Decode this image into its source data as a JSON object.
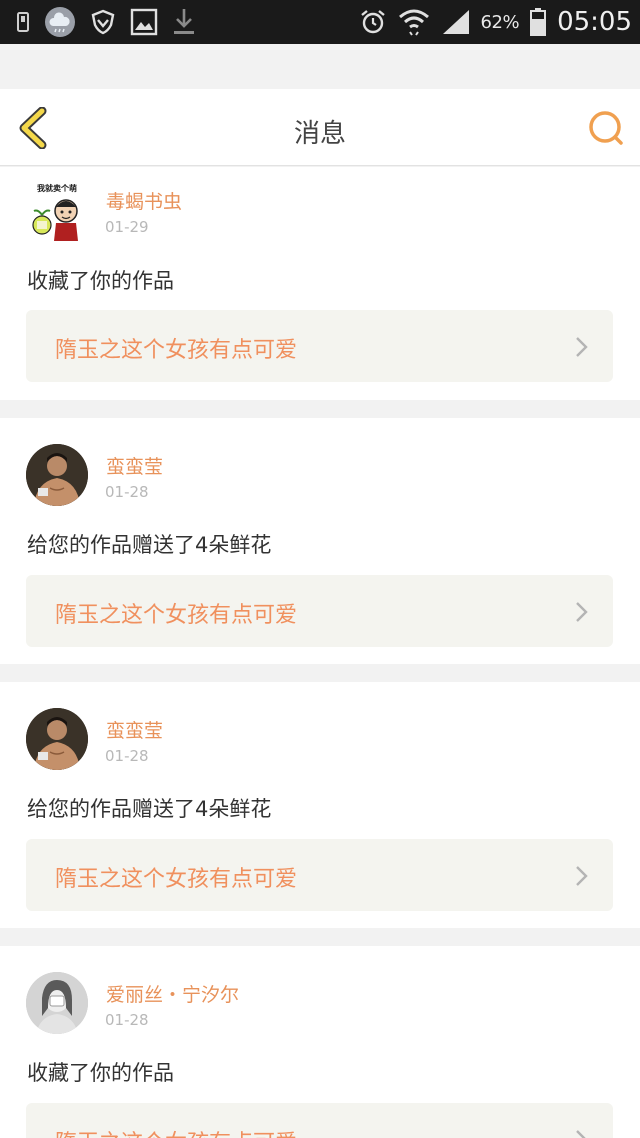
{
  "status_bar": {
    "battery_percent": "62%",
    "time": "05:05",
    "icons": [
      "sim-icon",
      "weather-cloud-icon",
      "shield-icon",
      "gallery-icon",
      "download-icon",
      "alarm-icon",
      "wifi-icon",
      "signal-icon",
      "battery-icon"
    ]
  },
  "header": {
    "title": "消息",
    "back_icon": "chevron-left-icon",
    "search_icon": "search-icon",
    "accent_color": "#f0a050"
  },
  "messages": [
    {
      "user": "毒蝎书虫",
      "date": "01-29",
      "action": "收藏了你的作品",
      "work_title": "隋玉之这个女孩有点可爱",
      "avatar_caption": "我就卖个萌"
    },
    {
      "user": "蛮蛮莹",
      "date": "01-28",
      "action": "给您的作品赠送了4朵鲜花",
      "work_title": "隋玉之这个女孩有点可爱"
    },
    {
      "user": "蛮蛮莹",
      "date": "01-28",
      "action": "给您的作品赠送了4朵鲜花",
      "work_title": "隋玉之这个女孩有点可爱"
    },
    {
      "user": "爱丽丝・宁汐尔",
      "date": "01-28",
      "action": "收藏了你的作品",
      "work_title": "隋玉之这个女孩有点可爱"
    }
  ],
  "colors": {
    "username": "#e8925a",
    "work_title": "#f0905e",
    "card_bg": "#ffffff",
    "page_bg": "#f2f2f2",
    "work_box_bg": "#f4f4ef"
  }
}
